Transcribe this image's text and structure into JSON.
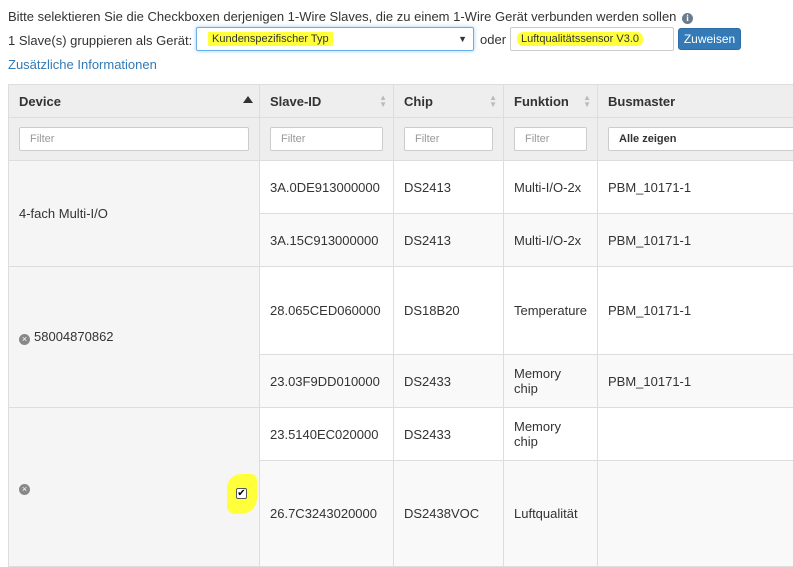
{
  "instruction_text": "Bitte selektieren Sie die Checkboxen derjenigen 1-Wire Slaves, die zu einem 1-Wire Gerät verbunden werden sollen",
  "info_icon_glyph": "i",
  "group_label": "1 Slave(s) gruppieren als Gerät:",
  "device_type_select": {
    "value": "Kundenspezifischer Typ",
    "caret": "▼"
  },
  "or_label": "oder",
  "existing_device_input": {
    "value": "Luftqualitätssensor V3.0"
  },
  "assign_button": "Zuweisen",
  "additional_info_link": "Zusätzliche Informationen",
  "table": {
    "columns": [
      "Device",
      "Slave-ID",
      "Chip",
      "Funktion",
      "Busmaster"
    ],
    "filter_placeholder": "Filter",
    "busmaster_filter_value": "Alle zeigen",
    "groups": [
      {
        "device": "4-fach Multi-I/O"
      },
      {
        "device": "58004870862"
      },
      {
        "device": "",
        "checkbox_checked": true
      }
    ],
    "rows": [
      {
        "slave_id": "3A.0DE913000000",
        "chip": "DS2413",
        "function": "Multi-I/O-2x",
        "busmaster": "PBM_10171-1"
      },
      {
        "slave_id": "3A.15C913000000",
        "chip": "DS2413",
        "function": "Multi-I/O-2x",
        "busmaster": "PBM_10171-1"
      },
      {
        "slave_id": "28.065CED060000",
        "chip": "DS18B20",
        "function": "Temperature",
        "busmaster": "PBM_10171-1"
      },
      {
        "slave_id": "23.03F9DD010000",
        "chip": "DS2433",
        "function": "Memory chip",
        "busmaster": "PBM_10171-1"
      },
      {
        "slave_id": "23.5140EC020000",
        "chip": "DS2433",
        "function": "Memory chip",
        "busmaster": ""
      },
      {
        "slave_id": "26.7C3243020000",
        "chip": "DS2438VOC",
        "function": "Luftqualität",
        "busmaster": ""
      }
    ]
  },
  "colors": {
    "highlight": "#ffff3a",
    "link": "#337ab7",
    "button": "#337ab7"
  },
  "icons": {
    "remove": "remove-icon",
    "sort_asc": "sort-asc-icon",
    "sort_both": "sort-both-icon",
    "checkmark": "✔"
  }
}
